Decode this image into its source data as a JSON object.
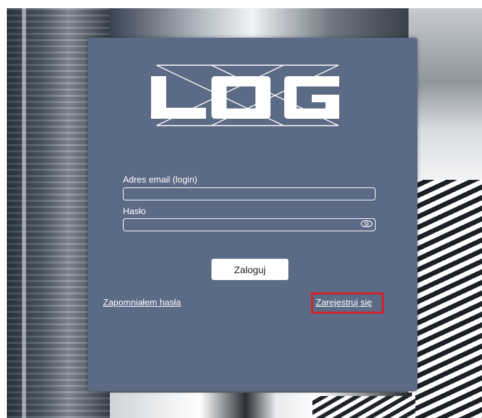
{
  "form": {
    "email_label": "Adres email (login)",
    "email_value": "",
    "password_label": "Hasło",
    "password_value": "",
    "login_button": "Zaloguj",
    "forgot_link": "Zapomniałem hasła",
    "register_link": "Zarejestruj się"
  },
  "logo": {
    "text": "LOG"
  },
  "colors": {
    "card": "#5b6a85",
    "highlight": "#d6202a",
    "text": "#ffffff"
  },
  "icons": {
    "password_toggle": "eye-icon"
  }
}
